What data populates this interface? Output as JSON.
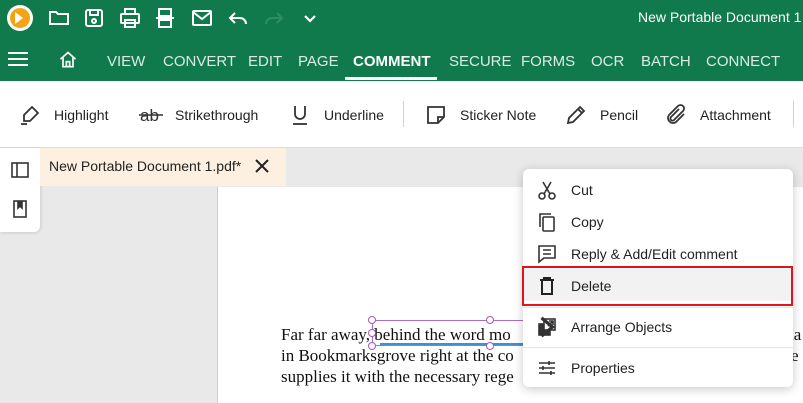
{
  "titlebar": {
    "doc_title": "New Portable Document 1",
    "quick_actions": [
      "open-folder-icon",
      "save-icon",
      "print-icon",
      "scan-icon",
      "email-icon",
      "undo-icon",
      "redo-icon",
      "chevron-down-icon"
    ]
  },
  "menu": {
    "tabs": [
      "VIEW",
      "CONVERT",
      "EDIT",
      "PAGE",
      "COMMENT",
      "SECURE",
      "FORMS",
      "OCR",
      "BATCH",
      "CONNECT"
    ],
    "active": "COMMENT"
  },
  "toolbar": {
    "highlight": "Highlight",
    "strikethrough": "Strikethrough",
    "underline": "Underline",
    "sticker_note": "Sticker Note",
    "pencil": "Pencil",
    "attachment": "Attachment"
  },
  "document": {
    "tab_label": "New Portable Document 1.pdf*",
    "lines": [
      "Far far away, behind the word mo",
      "in Bookmarksgrove right at the co",
      "supplies it with the necessary rege"
    ],
    "right_edge": [
      "ia",
      "e",
      ""
    ]
  },
  "context_menu": {
    "items": {
      "cut": "Cut",
      "copy": "Copy",
      "reply": "Reply & Add/Edit comment",
      "delete": "Delete",
      "arrange": "Arrange Objects",
      "properties": "Properties"
    }
  },
  "colors": {
    "brand_green": "#107a4c",
    "highlight_border": "#e0141a",
    "tab_bg": "#fdf0e0"
  }
}
